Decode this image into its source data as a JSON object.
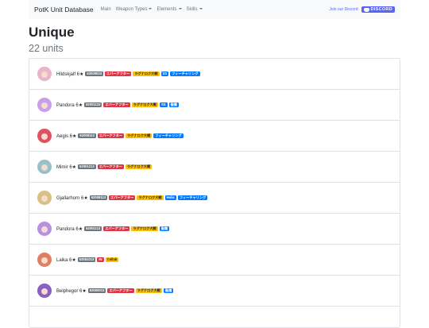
{
  "nav": {
    "brand": "PotK Unit Database",
    "items": [
      {
        "label": "Main",
        "dropdown": false
      },
      {
        "label": "Weapon Types",
        "dropdown": true
      },
      {
        "label": "Elements",
        "dropdown": true
      },
      {
        "label": "Skills",
        "dropdown": true
      }
    ],
    "join_text": "Join our Discord",
    "discord_label": "DISCORD"
  },
  "page": {
    "title": "Unique",
    "subtitle": "22 units"
  },
  "colors": {
    "id_badge": "#6c757d",
    "red_badge": "#dc3545",
    "yellow_badge": "#ffc107",
    "blue_badge": "#007bff",
    "discord": "#5865f2"
  },
  "units": [
    {
      "name": "Hlidskjalf 6★",
      "avatar_color": "#e8b4c8",
      "tags": [
        {
          "text": "62009023",
          "style": "id"
        },
        {
          "text": "エバーアフター",
          "style": "red"
        },
        {
          "text": "ラグナロク大戦",
          "style": "yellow"
        },
        {
          "text": "SS",
          "style": "blue"
        },
        {
          "text": "フィーチャリング",
          "style": "blue"
        }
      ]
    },
    {
      "name": "Pandora 6★",
      "avatar_color": "#c9a0e6",
      "tags": [
        {
          "text": "62001123",
          "style": "id"
        },
        {
          "text": "エバーアフター",
          "style": "red"
        },
        {
          "text": "ラグナロク大戦",
          "style": "yellow"
        },
        {
          "text": "SS",
          "style": "blue"
        },
        {
          "text": "聖魔",
          "style": "blue"
        }
      ]
    },
    {
      "name": "Aegis 6★",
      "avatar_color": "#e05060",
      "tags": [
        {
          "text": "62008113",
          "style": "id"
        },
        {
          "text": "エバーアフター",
          "style": "red"
        },
        {
          "text": "ラグナロク大戦",
          "style": "yellow"
        },
        {
          "text": "フィーチャリング",
          "style": "blue"
        }
      ]
    },
    {
      "name": "Mimir 6★",
      "avatar_color": "#9ac0c8",
      "tags": [
        {
          "text": "62001213",
          "style": "id"
        },
        {
          "text": "エバーアフター",
          "style": "red"
        },
        {
          "text": "ラグナロク大戦",
          "style": "yellow"
        }
      ]
    },
    {
      "name": "Gjallarhorn 6★",
      "avatar_color": "#d8c080",
      "tags": [
        {
          "text": "62008113",
          "style": "id"
        },
        {
          "text": "エバーアフター",
          "style": "red"
        },
        {
          "text": "ラグナロク大戦",
          "style": "yellow"
        },
        {
          "text": "Holic",
          "style": "blue"
        },
        {
          "text": "フィーチャリング",
          "style": "blue"
        }
      ]
    },
    {
      "name": "Pandora 6★",
      "avatar_color": "#b890e0",
      "tags": [
        {
          "text": "62001113",
          "style": "id"
        },
        {
          "text": "エバーアフター",
          "style": "red"
        },
        {
          "text": "ラグナロク大戦",
          "style": "yellow"
        },
        {
          "text": "聖魔",
          "style": "blue"
        }
      ]
    },
    {
      "name": "Laika 6★",
      "avatar_color": "#e08060",
      "tags": [
        {
          "text": "62061013",
          "style": "id"
        },
        {
          "text": "IN",
          "style": "red"
        },
        {
          "text": "Collab",
          "style": "yellow"
        }
      ]
    },
    {
      "name": "Belphegor 6★",
      "avatar_color": "#8a60c0",
      "tags": [
        {
          "text": "62000013",
          "style": "id"
        },
        {
          "text": "エバーアフター",
          "style": "red"
        },
        {
          "text": "ラグナロク大戦",
          "style": "yellow"
        },
        {
          "text": "聖魔",
          "style": "blue"
        }
      ]
    }
  ]
}
